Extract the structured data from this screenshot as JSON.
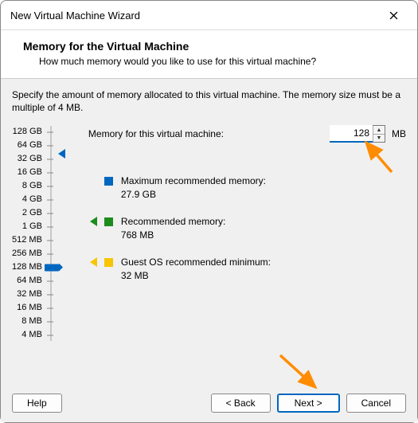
{
  "window": {
    "title": "New Virtual Machine Wizard"
  },
  "header": {
    "title": "Memory for the Virtual Machine",
    "subtitle": "How much memory would you like to use for this virtual machine?"
  },
  "instruction": "Specify the amount of memory allocated to this virtual machine. The memory size must be a multiple of 4 MB.",
  "field": {
    "label": "Memory for this virtual machine:",
    "value": "128",
    "unit": "MB"
  },
  "ruler": {
    "labels": [
      "128 GB",
      "64 GB",
      "32 GB",
      "16 GB",
      "8 GB",
      "4 GB",
      "2 GB",
      "1 GB",
      "512 MB",
      "256 MB",
      "128 MB",
      "64 MB",
      "32 MB",
      "16 MB",
      "8 MB",
      "4 MB"
    ],
    "thumb_index": 10
  },
  "markers": {
    "max": {
      "label": "Maximum recommended memory:",
      "value": "27.9 GB",
      "color": "#0067c0"
    },
    "rec": {
      "label": "Recommended memory:",
      "value": "768 MB",
      "color": "#1c8c1c"
    },
    "guest": {
      "label": "Guest OS recommended minimum:",
      "value": "32 MB",
      "color": "#f7c600"
    }
  },
  "buttons": {
    "help": "Help",
    "back": "< Back",
    "next": "Next >",
    "cancel": "Cancel"
  },
  "annotation_color": "#ff8c00"
}
